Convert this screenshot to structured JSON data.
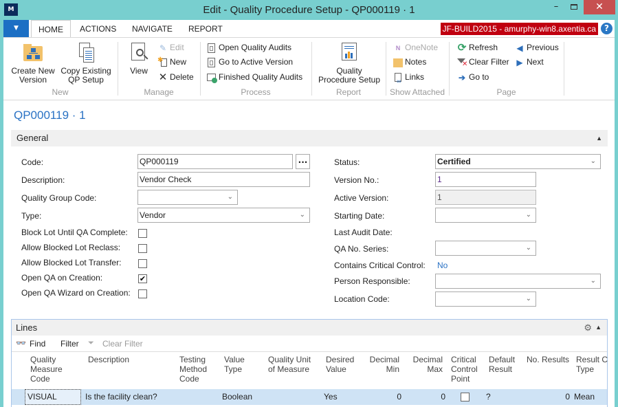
{
  "window": {
    "title": "Edit - Quality Procedure Setup - QP000119 · 1",
    "logo": "M",
    "minimize": "–",
    "close": "✕"
  },
  "ribbon_tabs": {
    "menu_icon": "▼",
    "tabs": [
      {
        "label": "HOME",
        "active": true
      },
      {
        "label": "ACTIONS",
        "active": false
      },
      {
        "label": "NAVIGATE",
        "active": false
      },
      {
        "label": "REPORT",
        "active": false
      }
    ],
    "server": "JF-BUILD2015 - amurphy-win8.axentia.ca",
    "help": "?"
  },
  "ribbon": {
    "groups": {
      "new": {
        "label": "New",
        "create_new_version": "Create New\nVersion",
        "copy_existing": "Copy Existing\nQP Setup"
      },
      "manage": {
        "label": "Manage",
        "view": "View",
        "edit": "Edit",
        "new": "New",
        "delete": "Delete"
      },
      "process": {
        "label": "Process",
        "open_audits": "Open Quality Audits",
        "go_active": "Go to Active Version",
        "finished_audits": "Finished Quality Audits"
      },
      "report": {
        "label": "Report",
        "qps": "Quality\nProcedure Setup"
      },
      "show_attached": {
        "label": "Show Attached",
        "onenote": "OneNote",
        "notes": "Notes",
        "links": "Links"
      },
      "page": {
        "label": "Page",
        "refresh": "Refresh",
        "clear_filter": "Clear Filter",
        "go_to": "Go to",
        "previous": "Previous",
        "next": "Next"
      }
    }
  },
  "page_title": "QP000119 · 1",
  "general": {
    "header": "General",
    "collapse_icon": "▲",
    "left": {
      "code": {
        "label": "Code:",
        "value": "QP000119",
        "lookup": "..."
      },
      "description": {
        "label": "Description:",
        "value": "Vendor Check"
      },
      "quality_group_code": {
        "label": "Quality Group Code:",
        "value": ""
      },
      "type": {
        "label": "Type:",
        "value": "Vendor"
      },
      "block_lot": {
        "label": "Block Lot Until QA Complete:",
        "checked": false
      },
      "allow_reclass": {
        "label": "Allow Blocked Lot Reclass:",
        "checked": false
      },
      "allow_transfer": {
        "label": "Allow Blocked Lot Transfer:",
        "checked": false
      },
      "open_qa": {
        "label": "Open QA on Creation:",
        "checked": true,
        "mark": "✔"
      },
      "open_wizard": {
        "label": "Open QA Wizard on Creation:",
        "checked": false
      }
    },
    "right": {
      "status": {
        "label": "Status:",
        "value": "Certified"
      },
      "version_no": {
        "label": "Version No.:",
        "value": "1"
      },
      "active_version": {
        "label": "Active Version:",
        "value": "1"
      },
      "starting_date": {
        "label": "Starting Date:",
        "value": ""
      },
      "last_audit_date": {
        "label": "Last Audit Date:",
        "value": ""
      },
      "qa_no_series": {
        "label": "QA No. Series:",
        "value": ""
      },
      "critical_control": {
        "label": "Contains Critical Control:",
        "value": "No"
      },
      "person_responsible": {
        "label": "Person Responsible:",
        "value": ""
      },
      "location_code": {
        "label": "Location Code:",
        "value": ""
      }
    }
  },
  "lines": {
    "header": "Lines",
    "collapse_icon": "▲",
    "toolbar": {
      "find": "Find",
      "filter": "Filter",
      "clear_filter": "Clear Filter"
    },
    "columns": [
      "Quality\nMeasure\nCode",
      "Description",
      "Testing\nMethod\nCode",
      "Value\nType",
      "Quality Unit\nof Measure",
      "Desired\nValue",
      "Decimal\nMin",
      "Decimal\nMax",
      "Critical\nControl\nPoint",
      "Default\nResult",
      "No. Results",
      "Result Ca\nType"
    ],
    "rows": [
      {
        "code": "VISUAL",
        "description": "Is the facility clean?",
        "testing_method": "",
        "value_type": "Boolean",
        "uom": "",
        "desired_value": "Yes",
        "decimal_min": "0",
        "decimal_max": "0",
        "critical_control": false,
        "default_result": "?",
        "no_results": "0",
        "result_calc_type": "Mean"
      }
    ]
  },
  "colors": {
    "accent": "#2a72c4",
    "window_frame": "#78cfcf",
    "server_badge": "#c00010",
    "selected_row": "#cfe3f5"
  }
}
